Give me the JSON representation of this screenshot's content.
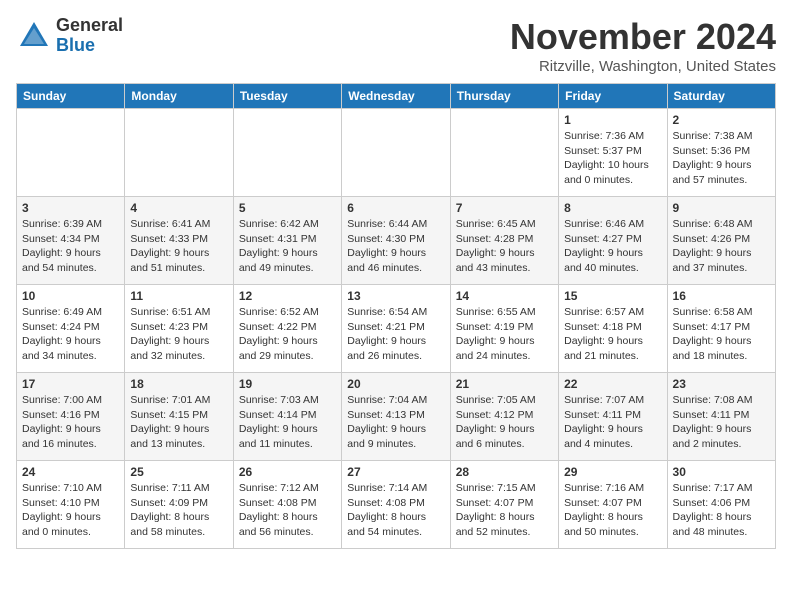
{
  "header": {
    "logo_line1": "General",
    "logo_line2": "Blue",
    "title": "November 2024",
    "subtitle": "Ritzville, Washington, United States"
  },
  "weekdays": [
    "Sunday",
    "Monday",
    "Tuesday",
    "Wednesday",
    "Thursday",
    "Friday",
    "Saturday"
  ],
  "weeks": [
    [
      {
        "day": "",
        "info": ""
      },
      {
        "day": "",
        "info": ""
      },
      {
        "day": "",
        "info": ""
      },
      {
        "day": "",
        "info": ""
      },
      {
        "day": "",
        "info": ""
      },
      {
        "day": "1",
        "info": "Sunrise: 7:36 AM\nSunset: 5:37 PM\nDaylight: 10 hours\nand 0 minutes."
      },
      {
        "day": "2",
        "info": "Sunrise: 7:38 AM\nSunset: 5:36 PM\nDaylight: 9 hours\nand 57 minutes."
      }
    ],
    [
      {
        "day": "3",
        "info": "Sunrise: 6:39 AM\nSunset: 4:34 PM\nDaylight: 9 hours\nand 54 minutes."
      },
      {
        "day": "4",
        "info": "Sunrise: 6:41 AM\nSunset: 4:33 PM\nDaylight: 9 hours\nand 51 minutes."
      },
      {
        "day": "5",
        "info": "Sunrise: 6:42 AM\nSunset: 4:31 PM\nDaylight: 9 hours\nand 49 minutes."
      },
      {
        "day": "6",
        "info": "Sunrise: 6:44 AM\nSunset: 4:30 PM\nDaylight: 9 hours\nand 46 minutes."
      },
      {
        "day": "7",
        "info": "Sunrise: 6:45 AM\nSunset: 4:28 PM\nDaylight: 9 hours\nand 43 minutes."
      },
      {
        "day": "8",
        "info": "Sunrise: 6:46 AM\nSunset: 4:27 PM\nDaylight: 9 hours\nand 40 minutes."
      },
      {
        "day": "9",
        "info": "Sunrise: 6:48 AM\nSunset: 4:26 PM\nDaylight: 9 hours\nand 37 minutes."
      }
    ],
    [
      {
        "day": "10",
        "info": "Sunrise: 6:49 AM\nSunset: 4:24 PM\nDaylight: 9 hours\nand 34 minutes."
      },
      {
        "day": "11",
        "info": "Sunrise: 6:51 AM\nSunset: 4:23 PM\nDaylight: 9 hours\nand 32 minutes."
      },
      {
        "day": "12",
        "info": "Sunrise: 6:52 AM\nSunset: 4:22 PM\nDaylight: 9 hours\nand 29 minutes."
      },
      {
        "day": "13",
        "info": "Sunrise: 6:54 AM\nSunset: 4:21 PM\nDaylight: 9 hours\nand 26 minutes."
      },
      {
        "day": "14",
        "info": "Sunrise: 6:55 AM\nSunset: 4:19 PM\nDaylight: 9 hours\nand 24 minutes."
      },
      {
        "day": "15",
        "info": "Sunrise: 6:57 AM\nSunset: 4:18 PM\nDaylight: 9 hours\nand 21 minutes."
      },
      {
        "day": "16",
        "info": "Sunrise: 6:58 AM\nSunset: 4:17 PM\nDaylight: 9 hours\nand 18 minutes."
      }
    ],
    [
      {
        "day": "17",
        "info": "Sunrise: 7:00 AM\nSunset: 4:16 PM\nDaylight: 9 hours\nand 16 minutes."
      },
      {
        "day": "18",
        "info": "Sunrise: 7:01 AM\nSunset: 4:15 PM\nDaylight: 9 hours\nand 13 minutes."
      },
      {
        "day": "19",
        "info": "Sunrise: 7:03 AM\nSunset: 4:14 PM\nDaylight: 9 hours\nand 11 minutes."
      },
      {
        "day": "20",
        "info": "Sunrise: 7:04 AM\nSunset: 4:13 PM\nDaylight: 9 hours\nand 9 minutes."
      },
      {
        "day": "21",
        "info": "Sunrise: 7:05 AM\nSunset: 4:12 PM\nDaylight: 9 hours\nand 6 minutes."
      },
      {
        "day": "22",
        "info": "Sunrise: 7:07 AM\nSunset: 4:11 PM\nDaylight: 9 hours\nand 4 minutes."
      },
      {
        "day": "23",
        "info": "Sunrise: 7:08 AM\nSunset: 4:11 PM\nDaylight: 9 hours\nand 2 minutes."
      }
    ],
    [
      {
        "day": "24",
        "info": "Sunrise: 7:10 AM\nSunset: 4:10 PM\nDaylight: 9 hours\nand 0 minutes."
      },
      {
        "day": "25",
        "info": "Sunrise: 7:11 AM\nSunset: 4:09 PM\nDaylight: 8 hours\nand 58 minutes."
      },
      {
        "day": "26",
        "info": "Sunrise: 7:12 AM\nSunset: 4:08 PM\nDaylight: 8 hours\nand 56 minutes."
      },
      {
        "day": "27",
        "info": "Sunrise: 7:14 AM\nSunset: 4:08 PM\nDaylight: 8 hours\nand 54 minutes."
      },
      {
        "day": "28",
        "info": "Sunrise: 7:15 AM\nSunset: 4:07 PM\nDaylight: 8 hours\nand 52 minutes."
      },
      {
        "day": "29",
        "info": "Sunrise: 7:16 AM\nSunset: 4:07 PM\nDaylight: 8 hours\nand 50 minutes."
      },
      {
        "day": "30",
        "info": "Sunrise: 7:17 AM\nSunset: 4:06 PM\nDaylight: 8 hours\nand 48 minutes."
      }
    ]
  ]
}
